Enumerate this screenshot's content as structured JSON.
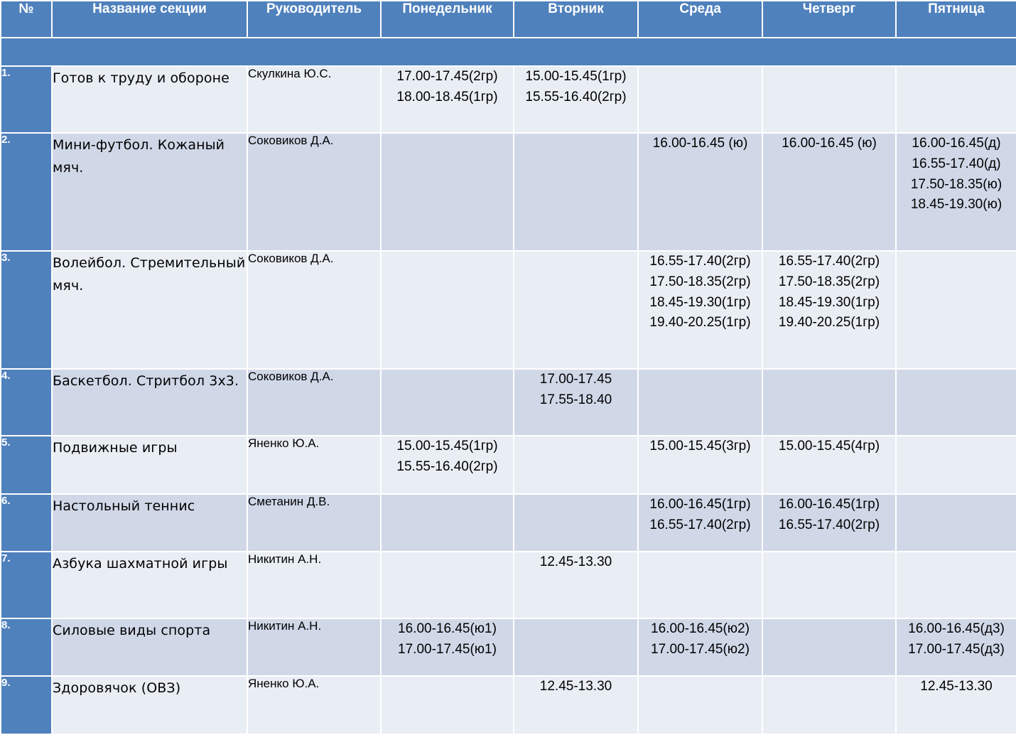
{
  "headers": [
    "№",
    "Название секции",
    "Руководитель",
    "Понедельник",
    "Вторник",
    "Среда",
    "Четверг",
    "Пятница"
  ],
  "rows": [
    {
      "num": "1.",
      "name": "Готов к труду и обороне",
      "leader": "Скулкина Ю.С.",
      "days": [
        [
          "17.00-17.45(2гр)",
          "18.00-18.45(1гр)"
        ],
        [
          "15.00-15.45(1гр)",
          "15.55-16.40(2гр)"
        ],
        [],
        [],
        []
      ]
    },
    {
      "num": "2.",
      "name": "Мини-футбол. Кожаный мяч.",
      "leader": "Соковиков Д.А.",
      "days": [
        [],
        [],
        [
          "16.00-16.45 (ю)"
        ],
        [
          "16.00-16.45 (ю)"
        ],
        [
          "16.00-16.45(д)",
          "16.55-17.40(д)",
          "17.50-18.35(ю)",
          "18.45-19.30(ю)"
        ]
      ]
    },
    {
      "num": "3.",
      "name": "Волейбол. Стремительный мяч.",
      "leader": "Соковиков Д.А.",
      "days": [
        [],
        [],
        [
          "16.55-17.40(2гр)",
          "17.50-18.35(2гр)",
          "18.45-19.30(1гр)",
          "19.40-20.25(1гр)"
        ],
        [
          "16.55-17.40(2гр)",
          "17.50-18.35(2гр)",
          "18.45-19.30(1гр)",
          "19.40-20.25(1гр)"
        ],
        []
      ]
    },
    {
      "num": "4.",
      "name": "Баскетбол. Стритбол 3х3.",
      "leader": "Соковиков Д.А.",
      "days": [
        [],
        [
          "17.00-17.45",
          "17.55-18.40"
        ],
        [],
        [],
        []
      ]
    },
    {
      "num": "5.",
      "name": "Подвижные игры",
      "leader": "Яненко Ю.А.",
      "days": [
        [
          "15.00-15.45(1гр)",
          "15.55-16.40(2гр)"
        ],
        [],
        [
          "15.00-15.45(3гр)"
        ],
        [
          "15.00-15.45(4гр)"
        ],
        []
      ]
    },
    {
      "num": "6.",
      "name": "Настольный теннис",
      "leader": "Сметанин Д.В.",
      "days": [
        [],
        [],
        [
          "16.00-16.45(1гр)",
          "16.55-17.40(2гр)"
        ],
        [
          "16.00-16.45(1гр)",
          "16.55-17.40(2гр)"
        ],
        []
      ]
    },
    {
      "num": "7.",
      "name": "Азбука шахматной игры",
      "leader": "Никитин А.Н.",
      "days": [
        [],
        [
          "12.45-13.30"
        ],
        [],
        [],
        []
      ]
    },
    {
      "num": "8.",
      "name": "Силовые виды спорта",
      "leader": "Никитин А.Н.",
      "days": [
        [
          "16.00-16.45(ю1)",
          "17.00-17.45(ю1)"
        ],
        [],
        [
          "16.00-16.45(ю2)",
          "17.00-17.45(ю2)"
        ],
        [],
        [
          "16.00-16.45(д3)",
          "17.00-17.45(д3)"
        ]
      ]
    },
    {
      "num": "9.",
      "name": "Здоровячок (ОВЗ)",
      "leader": "Яненко Ю.А.",
      "days": [
        [],
        [
          "12.45-13.30"
        ],
        [],
        [],
        [
          "12.45-13.30"
        ]
      ]
    }
  ],
  "colors": {
    "header": "#4f81bd",
    "row_light": "#e9edf4",
    "row_dark": "#d0d8e8"
  }
}
